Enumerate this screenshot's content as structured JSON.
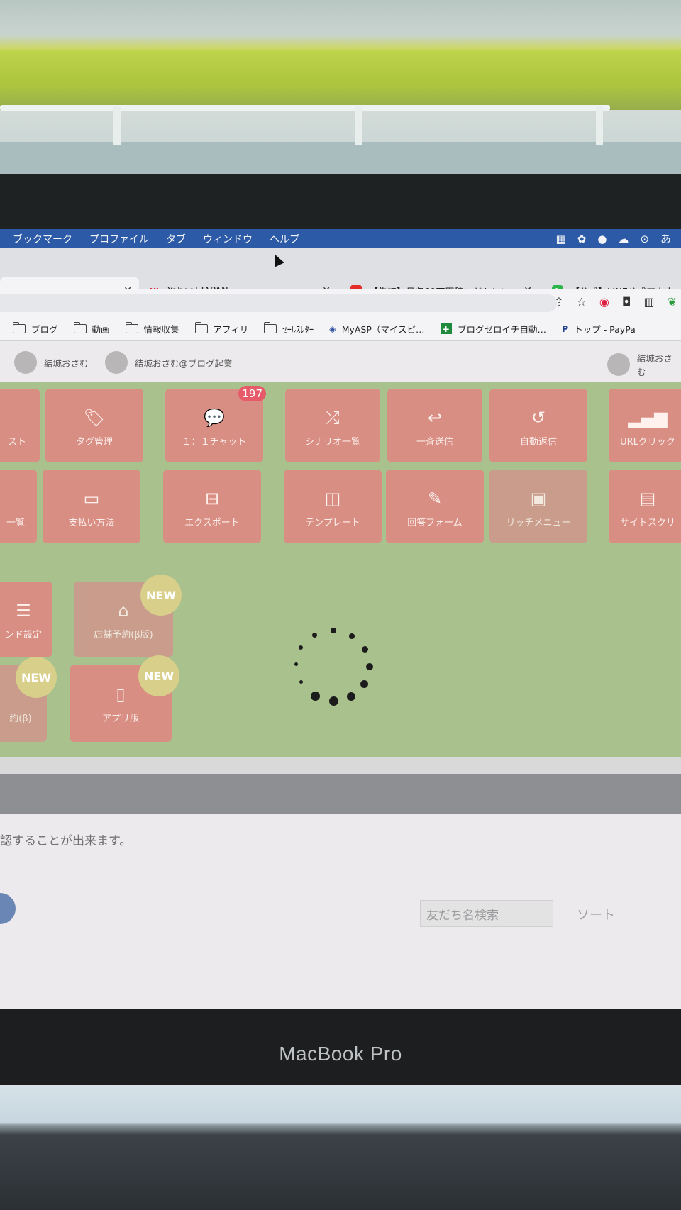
{
  "menubar": {
    "items": [
      "ブックマーク",
      "プロファイル",
      "タブ",
      "ウィンドウ",
      "ヘルプ"
    ],
    "ime_indicator": "あ"
  },
  "tabs": [
    {
      "title": "",
      "active": true
    },
    {
      "title": "Yahoo! JAPAN",
      "favicon": "Y!"
    },
    {
      "title": "【告知】月収69万円稼いだトレン",
      "favicon": "▶"
    },
    {
      "title": "【公式】LINE公式アカウ",
      "favicon": "L"
    }
  ],
  "bookmarks": [
    {
      "label": "ブログ",
      "icon": "folder-icon"
    },
    {
      "label": "動画",
      "icon": "folder-icon"
    },
    {
      "label": "情報収集",
      "icon": "folder-icon"
    },
    {
      "label": "アフィリ",
      "icon": "folder-icon"
    },
    {
      "label": "ｾｰﾙｽﾚﾀｰ",
      "icon": "folder-icon"
    },
    {
      "label": "MyASP（マイスピ…",
      "icon": "myasp-icon"
    },
    {
      "label": "ブログゼロイチ自動…",
      "icon": "plus-icon"
    },
    {
      "label": "トップ - PayPa",
      "icon": "paypal-icon"
    }
  ],
  "accounts": [
    "結城おさむ",
    "結城おさむ@ブログ起業",
    "結城おさむ"
  ],
  "tiles": {
    "row1": [
      {
        "label": "スト"
      },
      {
        "label": "タグ管理",
        "icon": "tag-icon"
      },
      {
        "label": "１：１チャット",
        "icon": "chat-icon",
        "badge": "197"
      },
      {
        "label": "シナリオ一覧",
        "icon": "shuffle-icon"
      },
      {
        "label": "一斉送信",
        "icon": "reply-icon"
      },
      {
        "label": "自動返信",
        "icon": "return-icon"
      },
      {
        "label": "URLクリック",
        "icon": "chart-search-icon"
      }
    ],
    "row2": [
      {
        "label": "一覧"
      },
      {
        "label": "支払い方法",
        "icon": "card-icon"
      },
      {
        "label": "エクスポート",
        "icon": "drive-icon"
      },
      {
        "label": "テンプレート",
        "icon": "columns-icon"
      },
      {
        "label": "回答フォーム",
        "icon": "clipboard-icon"
      },
      {
        "label": "リッチメニュー",
        "icon": "image-icon"
      },
      {
        "label": "サイトスクリ",
        "icon": "browser-icon"
      }
    ],
    "row3": [
      {
        "label": "ンド設定",
        "icon": "menu-icon"
      },
      {
        "label": "店舗予約(β版)",
        "icon": "store-icon",
        "new": "NEW"
      }
    ],
    "row4": [
      {
        "label": "約(β)",
        "new": "NEW"
      },
      {
        "label": "アプリ版",
        "icon": "phone-icon",
        "new": "NEW"
      }
    ]
  },
  "info_text": "認することが出来ます。",
  "search": {
    "placeholder": "友だち名検索"
  },
  "sort_label": "ソート",
  "laptop_label": "MacBook Pro"
}
